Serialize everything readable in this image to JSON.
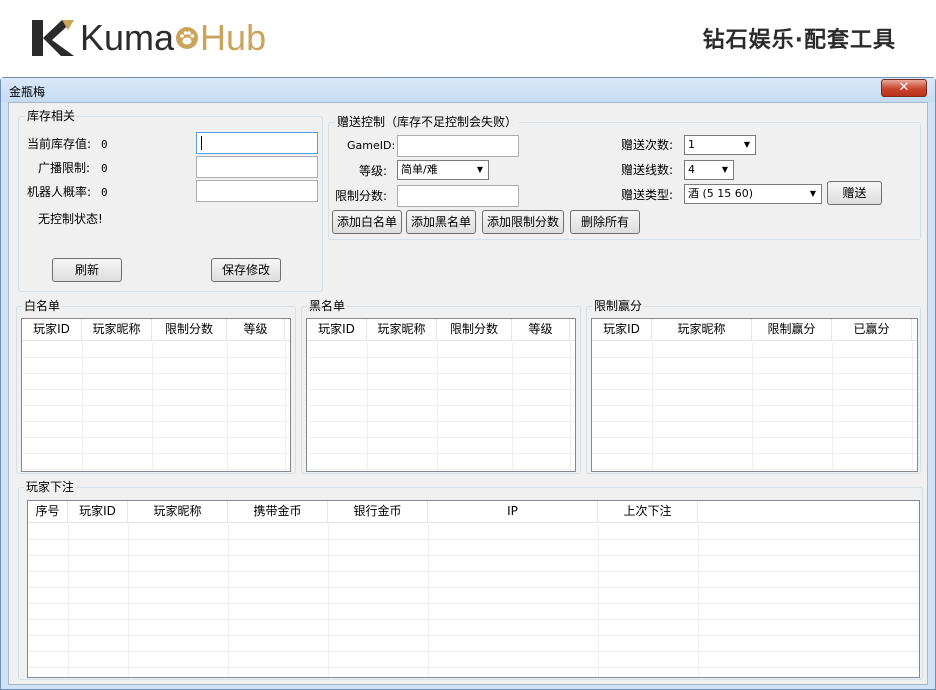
{
  "banner": {
    "logo_k": "Kuma",
    "logo_hub": "Hub",
    "tagline": "钻石娱乐·配套工具"
  },
  "window": {
    "title": "金瓶梅",
    "close_glyph": "✕"
  },
  "stock": {
    "group_title": "库存相关",
    "current_stock_label": "当前库存值:",
    "current_stock_value": "0",
    "broadcast_label": "广播限制:",
    "broadcast_value": "0",
    "robot_label": "机器人概率:",
    "robot_value": "0",
    "status": "无控制状态!",
    "refresh_button": "刷新",
    "save_button": "保存修改"
  },
  "gift": {
    "group_title": "赠送控制（库存不足控制会失败）",
    "gameid_label": "GameID:",
    "level_label": "等级:",
    "level_selected": "简单/难",
    "limit_score_label": "限制分数:",
    "count_label": "赠送次数:",
    "count_selected": "1",
    "lines_label": "赠送线数:",
    "lines_selected": "4",
    "type_label": "赠送类型:",
    "type_selected": "酒 (5 15 60)",
    "gift_button": "赠送",
    "add_whitelist": "添加白名单",
    "add_blacklist": "添加黑名单",
    "add_limit": "添加限制分数",
    "delete_all": "删除所有"
  },
  "whitelist": {
    "title": "白名单",
    "columns": [
      "玩家ID",
      "玩家昵称",
      "限制分数",
      "等级"
    ]
  },
  "blacklist": {
    "title": "黑名单",
    "columns": [
      "玩家ID",
      "玩家昵称",
      "限制分数",
      "等级"
    ]
  },
  "limitwin": {
    "title": "限制赢分",
    "columns": [
      "玩家ID",
      "玩家昵称",
      "限制赢分",
      "已赢分"
    ]
  },
  "bets": {
    "title": "玩家下注",
    "columns": [
      "序号",
      "玩家ID",
      "玩家昵称",
      "携带金币",
      "银行金币",
      "IP",
      "上次下注"
    ]
  }
}
